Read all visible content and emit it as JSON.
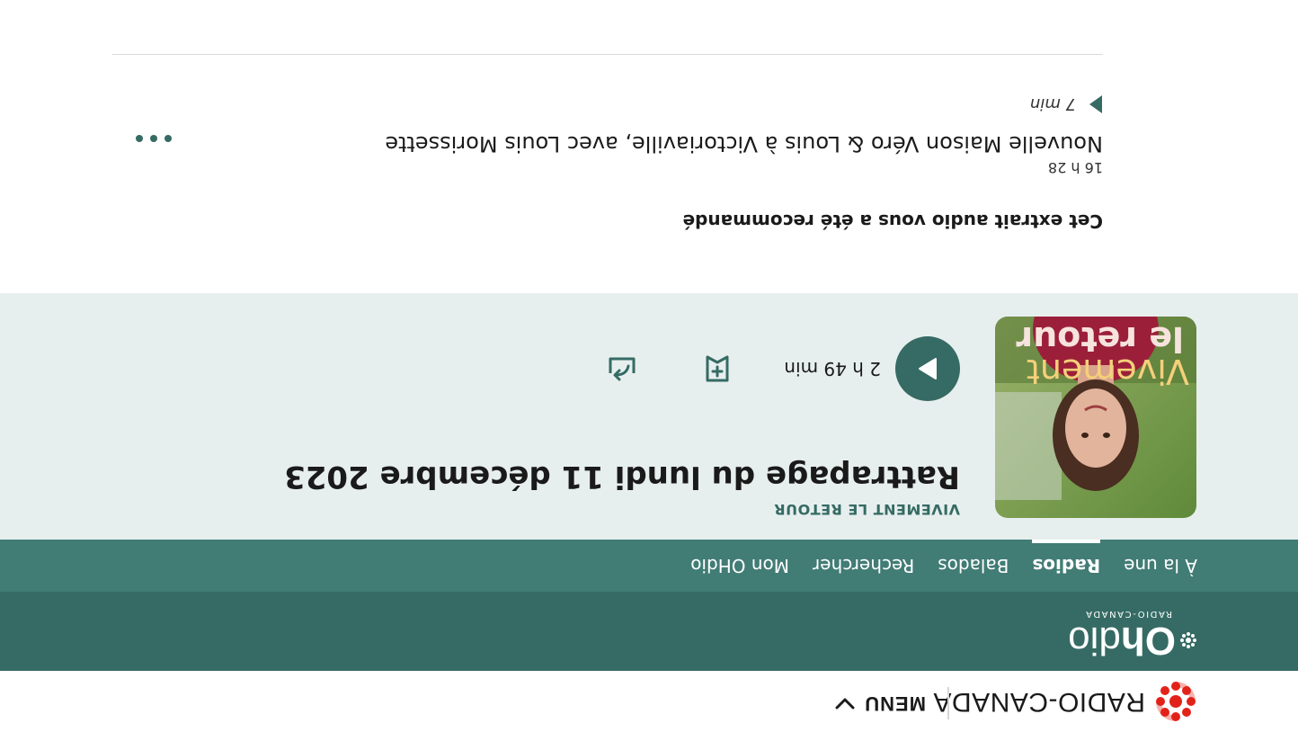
{
  "radio_canada": {
    "wordmark": "RADIO-CANADA",
    "menu_label": "MENU"
  },
  "ohdio": {
    "logo_bold": "Oh",
    "logo_rest": "dio",
    "logo_sub": "RADIO-CANADA"
  },
  "nav": {
    "tabs": [
      {
        "label": "À la une",
        "active": false
      },
      {
        "label": "Radios",
        "active": true
      },
      {
        "label": "Balados",
        "active": false
      },
      {
        "label": "Rechercher",
        "active": false
      },
      {
        "label": "Mon OHdio",
        "active": false
      }
    ]
  },
  "episode": {
    "cover_line1": "Vivement",
    "cover_line2": "le retour",
    "show_name": "VIVEMENT LE RETOUR",
    "title": "Rattrapage du lundi 11 décembre 2023",
    "duration": "2 h 49 min"
  },
  "recommendation": {
    "label": "Cet extrait audio vous a été recommandé",
    "time": "16 h 28",
    "title": "Nouvelle Maison Véro & Louis à Victoriaville, avec Louis Morissette",
    "duration": "7 min"
  },
  "colors": {
    "brand_dark": "#356b64",
    "brand_nav": "#417c75",
    "hero_bg": "#e7efee",
    "rc_red": "#e2231a"
  },
  "icons": [
    "radio-canada-gem-icon",
    "chevron-down-icon",
    "ohdio-gem-icon",
    "play-icon",
    "add-to-list-icon",
    "share-icon",
    "more-options-icon"
  ]
}
